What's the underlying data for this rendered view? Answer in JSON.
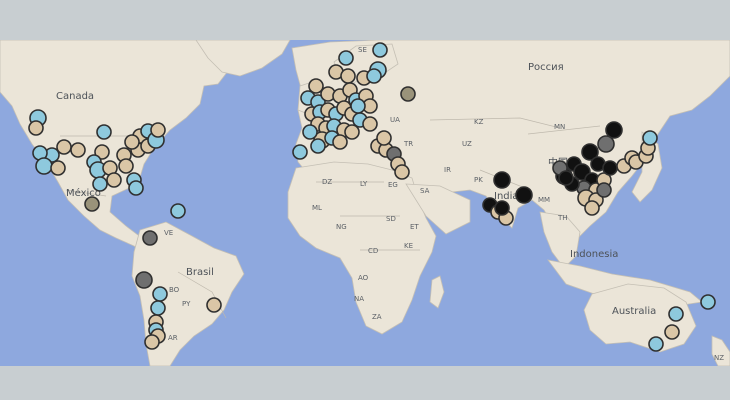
{
  "map": {
    "colors": {
      "ocean": "#8ea8de",
      "land": "#ebe5d8",
      "border": "#b9b4aa",
      "marker_light_blue": "#8ec9dd",
      "marker_tan": "#dac6a6",
      "marker_gray": "#6f6f6f",
      "marker_olive": "#9a937a",
      "marker_black": "#111111",
      "marker_stroke": "#2f2f2f"
    },
    "labels": {
      "canada": "Canada",
      "mexico": "México",
      "brasil": "Brasil",
      "russia": "Россия",
      "india": "India",
      "china": "中国",
      "indonesia": "Indonesia",
      "australia": "Australia",
      "se": "SE",
      "ua": "UA",
      "kz": "KZ",
      "mn": "MN",
      "uz": "UZ",
      "tr": "TR",
      "ir": "IR",
      "pk": "PK",
      "dz": "DZ",
      "ly": "LY",
      "eg": "EG",
      "sa": "SA",
      "ml": "ML",
      "ng": "NG",
      "sd": "SD",
      "et": "ET",
      "cd": "CD",
      "ke": "KE",
      "ao": "AO",
      "na": "NA",
      "za": "ZA",
      "ve": "VE",
      "bo": "BO",
      "py": "PY",
      "ar": "AR",
      "mm": "MM",
      "th": "TH",
      "nz": "NZ"
    },
    "marker_groups": [
      {
        "color": "#8ec9dd",
        "count": 60
      },
      {
        "color": "#dac6a6",
        "count": 96
      },
      {
        "color": "#6f6f6f",
        "count": 9
      },
      {
        "color": "#9a937a",
        "count": 4
      },
      {
        "color": "#111111",
        "count": 16
      }
    ]
  }
}
